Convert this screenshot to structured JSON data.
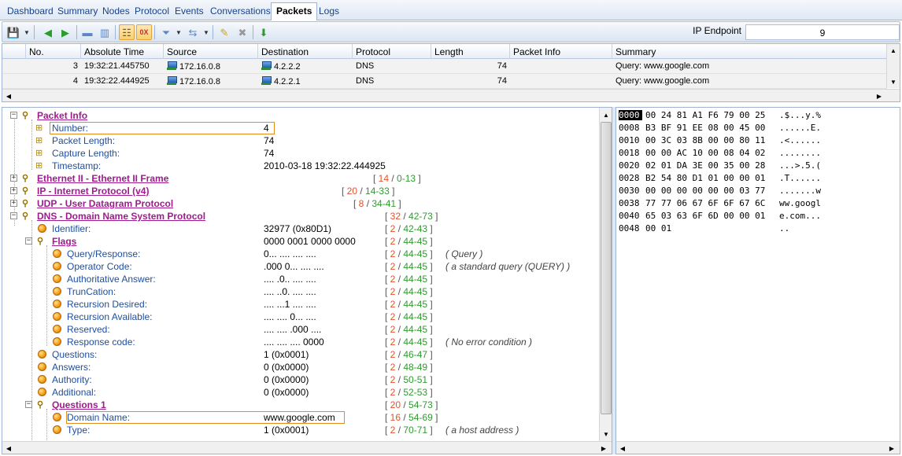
{
  "tabs": [
    "Dashboard",
    "Summary",
    "Nodes",
    "Protocol",
    "Events",
    "Conversations",
    "Packets",
    "Logs"
  ],
  "active_tab": "Packets",
  "toolbar": {
    "ip_endpoint_label": "IP Endpoint",
    "ip_endpoint_value": "9"
  },
  "packet_list": {
    "columns": [
      "No.",
      "Absolute Time",
      "Source",
      "Destination",
      "Protocol",
      "Length",
      "Packet Info",
      "Summary"
    ],
    "rows": [
      {
        "no": "3",
        "time": "19:32:21.445750",
        "source": "172.16.0.8",
        "destination": "4.2.2.2",
        "protocol": "DNS",
        "length": "74",
        "info": "",
        "summary": "Query: www.google.com"
      },
      {
        "no": "4",
        "time": "19:32:22.444925",
        "source": "172.16.0.8",
        "destination": "4.2.2.1",
        "protocol": "DNS",
        "length": "74",
        "info": "",
        "summary": "Query: www.google.com"
      }
    ]
  },
  "tree": {
    "packet_info": "Packet Info",
    "number_label": "Number:",
    "number_value": "4",
    "plen_label": "Packet Length:",
    "plen_value": "74",
    "clen_label": "Capture Length:",
    "clen_value": "74",
    "ts_label": "Timestamp:",
    "ts_value": "2010-03-18 19:32:22.444925",
    "eth": "Ethernet II - Ethernet II Frame",
    "eth_a": "14",
    "eth_b": "0-13",
    "ip": "IP - Internet Protocol (v4)",
    "ip_a": "20",
    "ip_b": "14-33",
    "udp": "UDP - User Datagram Protocol",
    "udp_a": "8",
    "udp_b": "34-41",
    "dns": "DNS - Domain Name System Protocol",
    "dns_a": "32",
    "dns_b": "42-73",
    "ident_label": "Identifier:",
    "ident_value": "32977 (0x80D1)",
    "ident_a": "2",
    "ident_b": "42-43",
    "flags": "Flags",
    "flags_value": "0000 0001 0000 0000",
    "flags_a": "2",
    "flags_b": "44-45",
    "qr_label": "Query/Response:",
    "qr_value": "0... .... .... ....",
    "qr_note": "( Query )",
    "op_label": "Operator Code:",
    "op_value": ".000 0... .... ....",
    "op_note": "( a standard query (QUERY) )",
    "aa_label": "Authoritative Answer:",
    "aa_value": ".... .0.. .... ....",
    "tc_label": "TrunCation:",
    "tc_value": ".... ..0. .... ....",
    "rd_label": "Recursion Desired:",
    "rd_value": ".... ...1 .... ....",
    "ra_label": "Recursion Available:",
    "ra_value": ".... .... 0... ....",
    "rs_label": "Reserved:",
    "rs_value": ".... .... .000 ....",
    "rc_label": "Response code:",
    "rc_value": ".... .... .... 0000",
    "rc_note": "( No error condition )",
    "q_label": "Questions:",
    "q_value": "1 (0x0001)",
    "q_a": "2",
    "q_b": "46-47",
    "an_label": "Answers:",
    "an_value": "0 (0x0000)",
    "an_a": "2",
    "an_b": "48-49",
    "au_label": "Authority:",
    "au_value": "0 (0x0000)",
    "au_a": "2",
    "au_b": "50-51",
    "ad_label": "Additional:",
    "ad_value": "0 (0x0000)",
    "ad_a": "2",
    "ad_b": "52-53",
    "q1": "Questions 1",
    "q1_a": "20",
    "q1_b": "54-73",
    "dn_label": "Domain Name:",
    "dn_value": "www.google.com",
    "dn_a": "16",
    "dn_b": "54-69",
    "ty_label": "Type:",
    "ty_value": "1 (0x0001)",
    "ty_a": "2",
    "ty_b": "70-71",
    "ty_note": "( a host address )"
  },
  "hex": [
    {
      "off": "0000",
      "bytes": "00 24 81 A1 F6 79 00 25",
      "ascii": ".$...y.%"
    },
    {
      "off": "0008",
      "bytes": "B3 BF 91 EE 08 00 45 00",
      "ascii": "......E."
    },
    {
      "off": "0010",
      "bytes": "00 3C 03 8B 00 00 80 11",
      "ascii": ".<......"
    },
    {
      "off": "0018",
      "bytes": "00 00 AC 10 00 08 04 02",
      "ascii": "........"
    },
    {
      "off": "0020",
      "bytes": "02 01 DA 3E 00 35 00 28",
      "ascii": "...>.5.("
    },
    {
      "off": "0028",
      "bytes": "B2 54 80 D1 01 00 00 01",
      "ascii": ".T......"
    },
    {
      "off": "0030",
      "bytes": "00 00 00 00 00 00 03 77",
      "ascii": ".......w"
    },
    {
      "off": "0038",
      "bytes": "77 77 06 67 6F 6F 67 6C",
      "ascii": "ww.googl"
    },
    {
      "off": "0040",
      "bytes": "65 03 63 6F 6D 00 00 01",
      "ascii": "e.com..."
    },
    {
      "off": "0048",
      "bytes": "00 01",
      "ascii": ".."
    }
  ],
  "colors": {
    "section": "#a01b8f",
    "field": "#1f4fa0",
    "range_len": "#e5532b",
    "range_off": "#2e9b2e",
    "highlight_border": "#e58a1f"
  }
}
